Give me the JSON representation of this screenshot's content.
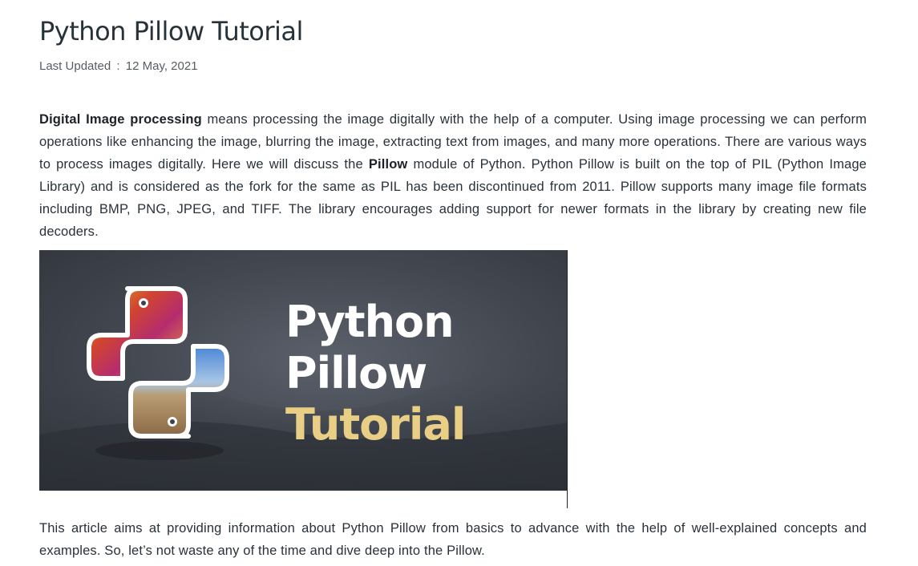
{
  "article": {
    "title": "Python Pillow Tutorial",
    "meta": {
      "label": "Last Updated",
      "separator": ":",
      "date": "12 May, 2021"
    },
    "intro": {
      "b1": "Digital Image processing",
      "t1": " means processing the image digitally with the help of a computer. Using image processing we can perform operations like enhancing the image, blurring the image, extracting text from images, and many more operations. There are various ways to process images digitally. Here we will discuss the ",
      "b2": "Pillow",
      "t2": " module of Python. Python Pillow is built on the top of PIL (Python Image Library) and is considered as the fork for the same as PIL has been discontinued from 2011. Pillow supports many image file formats including BMP, PNG, JPEG, and TIFF. The library encourages adding support for newer formats in the library by creating new file decoders."
    },
    "banner": {
      "line1": "Python",
      "line2": "Pillow",
      "line3": "Tutorial",
      "colors": {
        "text": "#ffffff",
        "accent": "#e9cf85",
        "background": "#454a53"
      },
      "logo_icon": "python-logo-icon"
    },
    "outro": "This article aims at providing information about Python Pillow from basics to advance with the help of well-explained concepts and examples. So, let’s not waste any of the time and dive deep into the Pillow."
  }
}
